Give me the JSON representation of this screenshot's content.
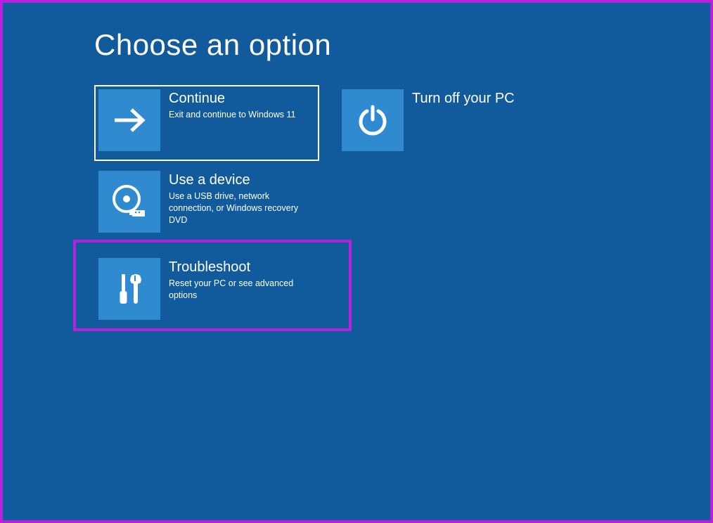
{
  "title": "Choose an option",
  "options": {
    "continue": {
      "title": "Continue",
      "desc": "Exit and continue to Windows 11"
    },
    "turnoff": {
      "title": "Turn off your PC",
      "desc": ""
    },
    "useadevice": {
      "title": "Use a device",
      "desc": "Use a USB drive, network connection, or Windows recovery DVD"
    },
    "troubleshoot": {
      "title": "Troubleshoot",
      "desc": "Reset your PC or see advanced options"
    }
  }
}
